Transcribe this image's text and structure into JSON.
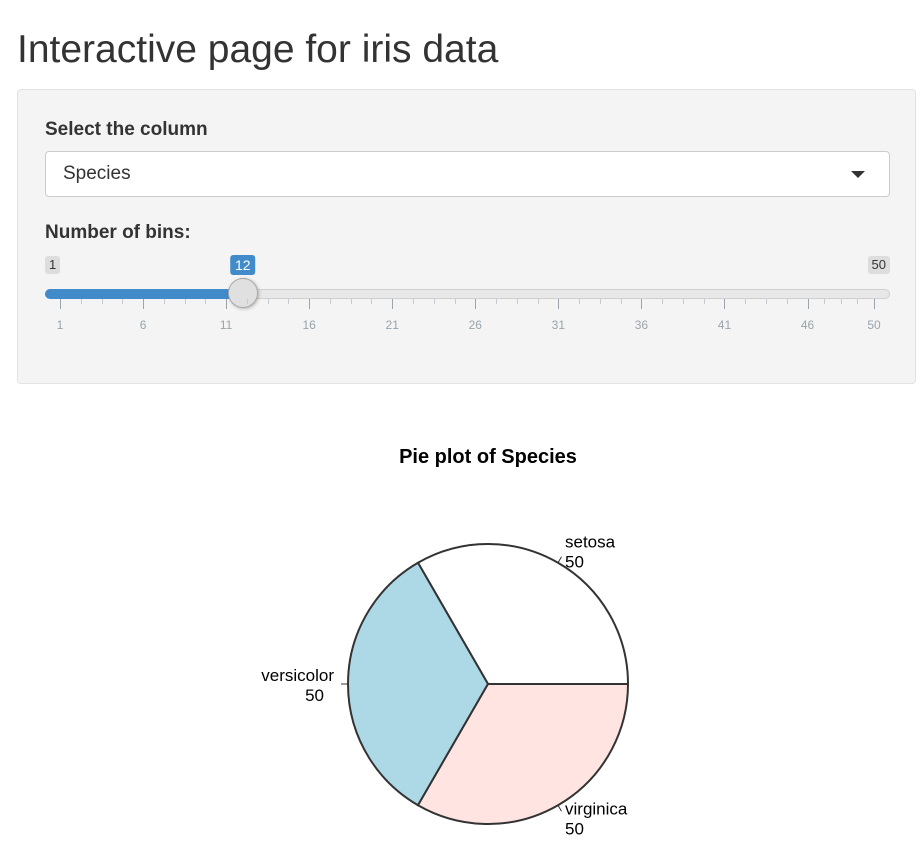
{
  "page": {
    "title": "Interactive page for iris data"
  },
  "column_select": {
    "label": "Select the column",
    "value": "Species"
  },
  "bins_slider": {
    "label": "Number of bins:",
    "min": 1,
    "max": 50,
    "value": 12,
    "min_label": "1",
    "max_label": "50",
    "value_label": "12",
    "grid_labels": [
      "1",
      "6",
      "11",
      "16",
      "21",
      "26",
      "31",
      "36",
      "41",
      "46",
      "50"
    ],
    "accent_color": "#428bca"
  },
  "chart_data": {
    "type": "pie",
    "title": "Pie plot of Species",
    "slices": [
      {
        "label": "setosa",
        "value": 50,
        "value_label": "50",
        "color": "#ffffff"
      },
      {
        "label": "versicolor",
        "value": 50,
        "value_label": "50",
        "color": "#add8e6"
      },
      {
        "label": "virginica",
        "value": 50,
        "value_label": "50",
        "color": "#ffe4e1"
      }
    ],
    "start_angle_deg": 0,
    "direction": "counterclockwise"
  }
}
